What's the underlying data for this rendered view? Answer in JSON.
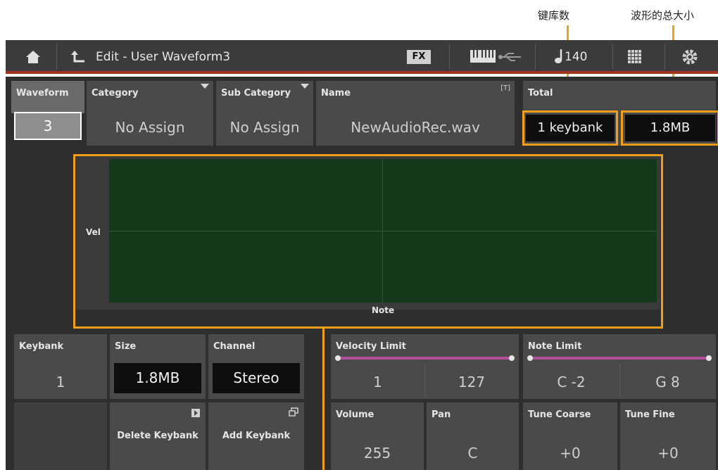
{
  "annotations": {
    "keybank_count": "键库数",
    "total_size": "波形的总大小"
  },
  "header": {
    "title": "Edit - User Waveform3",
    "fx_label": "FX",
    "tempo": "140"
  },
  "fields": {
    "waveform": {
      "label": "Waveform",
      "value": "3"
    },
    "category": {
      "label": "Category",
      "value": "No Assign"
    },
    "sub_category": {
      "label": "Sub Category",
      "value": "No Assign"
    },
    "name": {
      "label": "Name",
      "value": "NewAudioRec.wav",
      "tag": "[T]"
    },
    "total": {
      "label": "Total",
      "keybank_value": "1 keybank",
      "size_value": "1.8MB"
    }
  },
  "graph": {
    "y_label": "Vel",
    "x_label": "Note"
  },
  "keybank": {
    "keybank": {
      "label": "Keybank",
      "value": "1"
    },
    "size": {
      "label": "Size",
      "value": "1.8MB"
    },
    "channel": {
      "label": "Channel",
      "value": "Stereo"
    },
    "delete_label": "Delete Keybank",
    "add_label": "Add Keybank"
  },
  "limits": {
    "velocity": {
      "label": "Velocity Limit",
      "low": "1",
      "high": "127"
    },
    "note": {
      "label": "Note Limit",
      "low": "C -2",
      "high": "G 8"
    }
  },
  "params": {
    "volume": {
      "label": "Volume",
      "value": "255"
    },
    "pan": {
      "label": "Pan",
      "value": "C"
    },
    "tune_coarse": {
      "label": "Tune Coarse",
      "value": "+0"
    },
    "tune_fine": {
      "label": "Tune Fine",
      "value": "+0"
    }
  },
  "colors": {
    "accent": "#f59e1b",
    "header_bar": "#a0321e",
    "graph_bg": "#16381a",
    "slider": "#b0509a"
  },
  "icons": [
    "home-icon",
    "back-icon",
    "keyboard-icon",
    "usb-icon",
    "note-icon",
    "grid-icon",
    "gear-icon",
    "play-icon",
    "window-icon"
  ]
}
